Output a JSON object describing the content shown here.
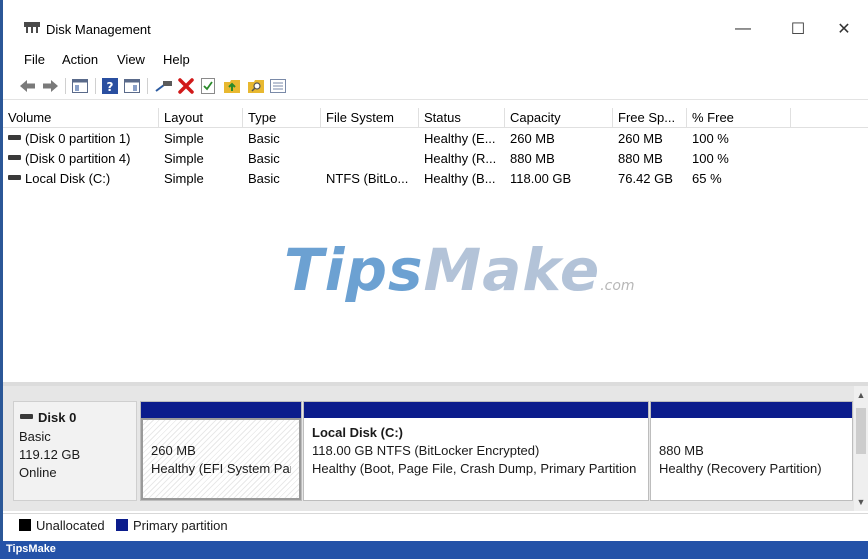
{
  "window": {
    "title": "Disk Management",
    "minimize_glyph": "—",
    "maximize_glyph": "☐",
    "close_glyph": "✕"
  },
  "menu": [
    "File",
    "Action",
    "View",
    "Help"
  ],
  "toolbar_icons": [
    "back-icon",
    "forward-icon",
    "console-tree-icon",
    "help-icon",
    "properties-icon",
    "connect-icon",
    "delete-icon",
    "check-icon",
    "up-folder-icon",
    "search-folder-icon",
    "list-icon"
  ],
  "columns": [
    "Volume",
    "Layout",
    "Type",
    "File System",
    "Status",
    "Capacity",
    "Free Sp...",
    "% Free"
  ],
  "volumes": [
    {
      "volume": "(Disk 0 partition 1)",
      "layout": "Simple",
      "type": "Basic",
      "fs": "",
      "status": "Healthy (E...",
      "capacity": "260 MB",
      "free": "260 MB",
      "pct": "100 %"
    },
    {
      "volume": "(Disk 0 partition 4)",
      "layout": "Simple",
      "type": "Basic",
      "fs": "",
      "status": "Healthy (R...",
      "capacity": "880 MB",
      "free": "880 MB",
      "pct": "100 %"
    },
    {
      "volume": "Local Disk (C:)",
      "layout": "Simple",
      "type": "Basic",
      "fs": "NTFS (BitLo...",
      "status": "Healthy (B...",
      "capacity": "118.00 GB",
      "free": "76.42 GB",
      "pct": "65 %"
    }
  ],
  "watermark": {
    "tips": "Tips",
    "make": "Make",
    "com": ".com"
  },
  "disk": {
    "name": "Disk 0",
    "type": "Basic",
    "size": "119.12 GB",
    "state": "Online"
  },
  "partitions": [
    {
      "title": "",
      "line1": "260 MB",
      "line2": "Healthy (EFI System Part"
    },
    {
      "title": "Local Disk  (C:)",
      "line1": "118.00 GB NTFS (BitLocker Encrypted)",
      "line2": "Healthy (Boot, Page File, Crash Dump, Primary Partition"
    },
    {
      "title": "",
      "line1": "880 MB",
      "line2": "Healthy (Recovery Partition)"
    }
  ],
  "legend": [
    {
      "label": "Unallocated",
      "color": "#000000"
    },
    {
      "label": "Primary partition",
      "color": "#0b1c8c"
    }
  ],
  "brand": "TipsMake",
  "colors": {
    "primary_partition": "#0b1c8c",
    "bottom_band": "#2452a8"
  }
}
